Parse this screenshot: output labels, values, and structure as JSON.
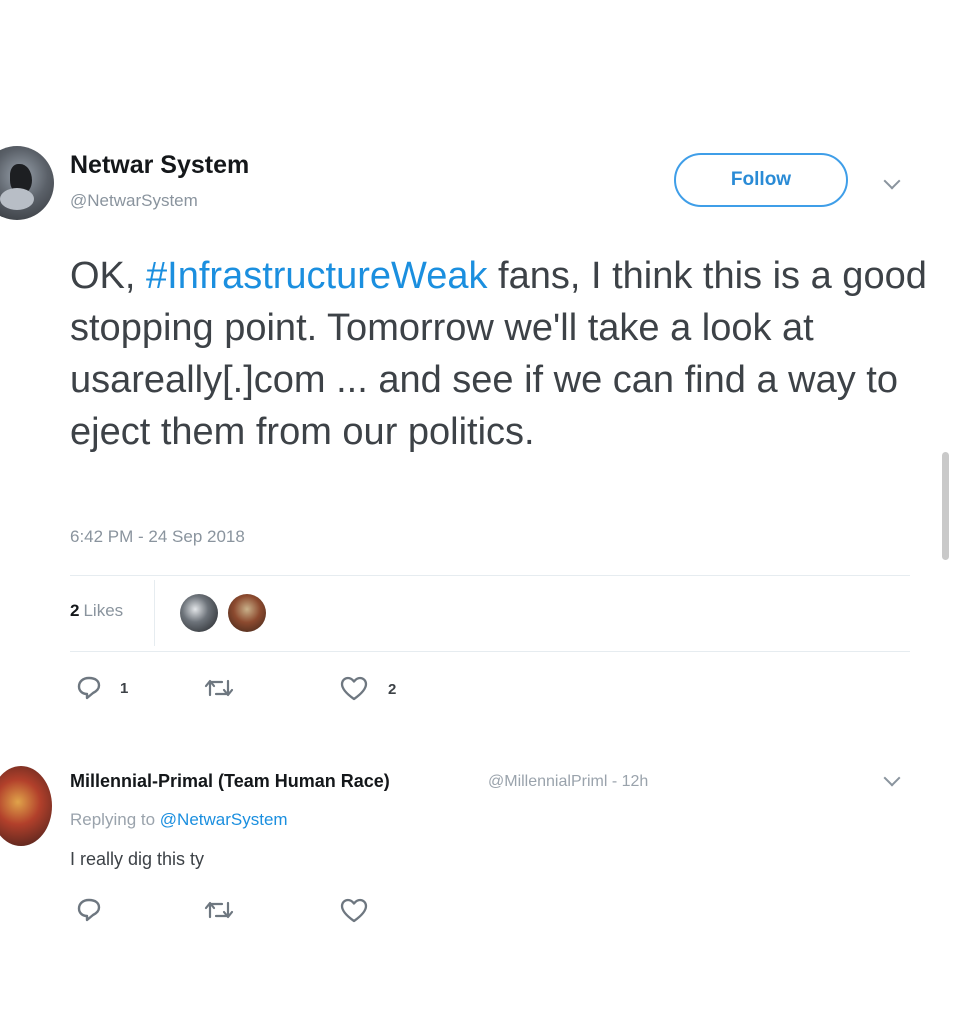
{
  "tweet": {
    "display_name": "Netwar System",
    "handle": "@NetwarSystem",
    "follow_label": "Follow",
    "text_before": "OK, ",
    "hashtag": "#InfrastructureWeak",
    "text_after": " fans, I think this is a good stopping point. Tomorrow we'll take a look at usareally[.]com ... and see if we can find a way to eject them from our politics.",
    "timestamp": "6:42 PM - 24 Sep 2018",
    "likes_count": "2",
    "likes_label": "Likes",
    "reply_count": "1",
    "retweet_count": "",
    "like_count": "2",
    "icons": {
      "avatar": "avatar-image",
      "caret": "chevron-down-icon",
      "reply": "reply-icon",
      "retweet": "retweet-icon",
      "like": "heart-icon"
    }
  },
  "reply": {
    "display_name": "Millennial-Primal (Team Human Race)",
    "handle_time": "@MillennialPriml - 12h",
    "replying_label": "Replying to ",
    "replying_mention": "@NetwarSystem",
    "text": "I really dig this ty"
  },
  "colors": {
    "accent": "#1b8fdf",
    "muted": "#8a949e",
    "text": "#3d4247"
  }
}
